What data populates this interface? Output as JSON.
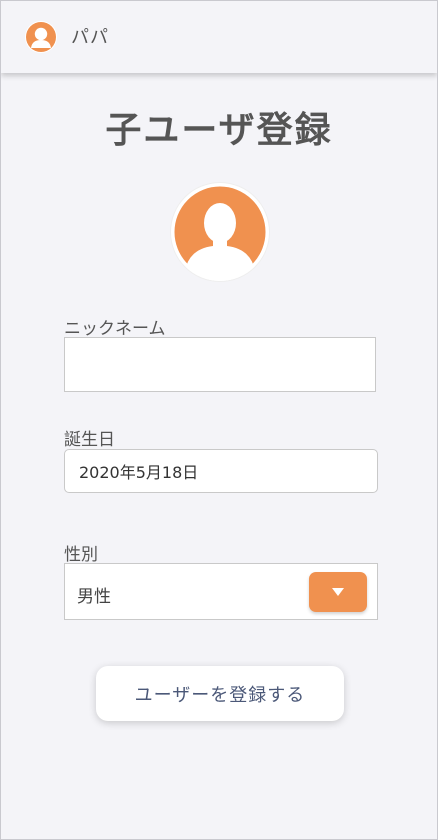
{
  "header": {
    "user_name": "パパ",
    "avatar_icon": "user-avatar-icon"
  },
  "page": {
    "title": "子ユーザ登録"
  },
  "avatar": {
    "icon": "user-silhouette-icon",
    "color": "#F0914F"
  },
  "form": {
    "nickname": {
      "label": "ニックネーム",
      "value": ""
    },
    "birthday": {
      "label": "誕生日",
      "value": "2020年5月18日"
    },
    "gender": {
      "label": "性別",
      "value": "男性",
      "toggle_icon": "triangle-down-icon"
    },
    "submit_label": "ユーザーを登録する"
  },
  "colors": {
    "accent": "#F0914F",
    "title_text": "#555555",
    "button_text": "#4B5878",
    "background": "#F4F4F8"
  }
}
